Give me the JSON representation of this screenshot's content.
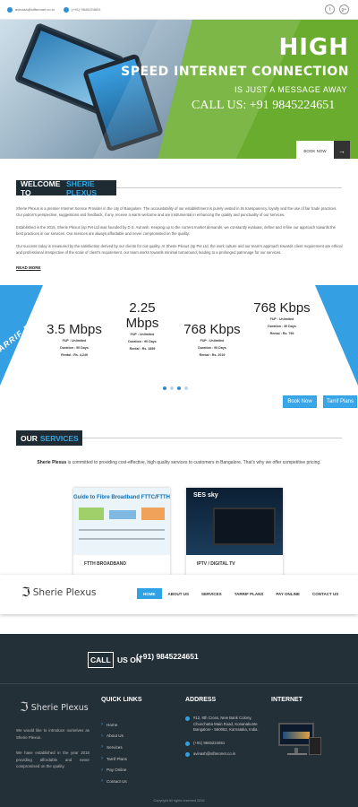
{
  "topbar": {
    "email": "avinash@sifteronet.co.in",
    "phone": "(+91) 9845224651",
    "social": [
      "f",
      "g+"
    ]
  },
  "hero": {
    "title": "HIGH",
    "subtitle": "SPEED INTERNET CONNECTION",
    "tagline": "IS JUST A MESSAGE AWAY",
    "call": "CALL US: +91 9845224651",
    "book_label": "BOOK NOW",
    "book_arrow": "→"
  },
  "welcome": {
    "title_prefix": "WELCOME TO",
    "title_brand": "SHERIE PLEXUS",
    "p1": "Sherie Plexus is a premier Internet Service Provider in the city of Bangalore. The accountability of our establishment is purely vested in its transparency, loyalty and the use of fair trade practices. Our patron's perspective, suggestions and feedback, if any, receive a warm welcome and are instrumental in enhancing the quality and punctuality of our services.",
    "p2": "Established in the 2015, Sherie Plexus (sp Pvt Ltd was founded by D.S. Avinash. Keeping up to the current market demands, we constantly evaluate, define and refine our approach towards the best practices in our services. Our services are always affordable and never compromised on the quality.",
    "p3": "Our success today is measured by the satisfaction derived by our clients for our quality. At Sherie Plexus (sp Pvt Ltd, the work culture and our team's approach towards client requirement are ethical and professional irrespective of the scale of client's requirement, our team works towards minimal turnaround, leading to a prolonged patronage for our services.",
    "read_more": "READ MORE"
  },
  "tariff": {
    "left_band": "TARRIF PLANS",
    "right_band": "TARRIF PLANS",
    "plans": [
      {
        "speed": "3.5 Mbps",
        "fup": "FUP : Unlimited",
        "duration": "Duration : 90 Days",
        "rental": "Rental : Rs. 4,249"
      },
      {
        "speed": "2.25 Mbps",
        "fup": "FUP : Unlimited",
        "duration": "Duration : 90 Days",
        "rental": "Rental : Rs. 2895"
      },
      {
        "speed": "768 Kbps",
        "fup": "FUP : Unlimited",
        "duration": "Duration : 90 Days",
        "rental": "Rental : Rs. 2019"
      },
      {
        "speed": "768 Kbps",
        "fup": "FUP : Unlimited",
        "duration": "Duration : 30 Days",
        "rental": "Rental : Rs. 799"
      }
    ],
    "book_now": "Book Now",
    "tarrif_plans_btn": "Tarrif Plans"
  },
  "services": {
    "title_prefix": "OUR",
    "title_brand": "SERVICES",
    "intro_brand": "Sherie Plexus",
    "intro_rest": " is committed to providing cost-effective, high quality services to customers in Bangalore. That's why we offer competitive pricing.",
    "cards": [
      {
        "label": "FTTH BROADBAND",
        "img_title": "Guide to Fibre Broadband FTTC/FTTH"
      },
      {
        "label": "IPTV / DIGITAL TV",
        "img_title": "SES sky"
      }
    ]
  },
  "nav": {
    "logo_text": "Sherie Plexus",
    "items": [
      "HOME",
      "ABOUT US",
      "SERVICES",
      "TARRIF PLANS",
      "PAY ONLINE",
      "CONTACT US"
    ]
  },
  "footer": {
    "call_label_box": "CALL",
    "call_label_rest": " US ON",
    "call_phone": "(+91) 9845224651",
    "logo_text": "Sherie Plexus",
    "intro_1": "We would like to introduce ourselves as Sherie Plexus.",
    "intro_2": "We have established in the year 2015 providing affordable and never compromised on the quality.",
    "quick_links_title": "QUICK LINKS",
    "quick_links": [
      "Home",
      "About Us",
      "Services",
      "Tarrif Plans",
      "Pay Online",
      "Contact Us"
    ],
    "address_title": "ADDRESS",
    "address": "#12, 8th Cross, New Bank Colony, Chunchatta Main Road, Konanakunte Bangalore - 560062, Karnataka, India.",
    "phone": "(+91) 9845224651",
    "email": "avinash@sifteronet.co.in",
    "internet_title": "INTERNET",
    "copyright": "Copyright All rights reserved 2016"
  },
  "colors": {
    "accent": "#2fa2e6",
    "hero_green": "#6aad2e",
    "dark": "#1f2b33",
    "footer_bg": "#243038"
  }
}
